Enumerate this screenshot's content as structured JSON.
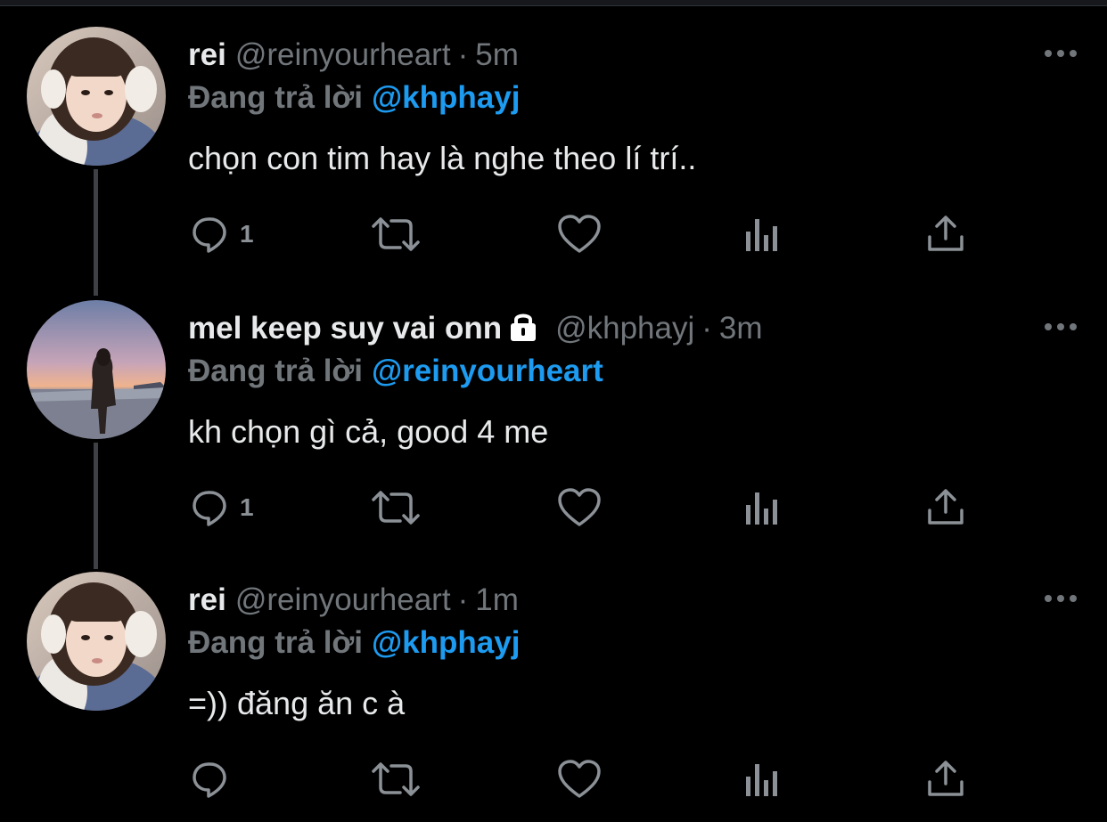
{
  "colors": {
    "background": "#000000",
    "name": "#e7e9ea",
    "muted": "#71767b",
    "mention": "#1d9bf0",
    "thread_line": "#3d4145"
  },
  "tweets": [
    {
      "name": "rei",
      "handle": "@reinyourheart",
      "separator": "·",
      "time": "5m",
      "reply_label": "Đang trả lời",
      "reply_to": "@khphayj",
      "text": "chọn con tim hay là nghe theo lí trí..",
      "reply_count": "1",
      "avatar_icon": "avatar-girl-headphones"
    },
    {
      "name": "mel keep suy vai onn",
      "handle": "@khphayj",
      "separator": "·",
      "time": "3m",
      "reply_label": "Đang trả lời",
      "reply_to": "@reinyourheart",
      "text": "kh chọn gì cả, good 4 me",
      "reply_count": "1",
      "protected_icon": "lock-icon",
      "avatar_icon": "avatar-sunset-silhouette"
    },
    {
      "name": "rei",
      "handle": "@reinyourheart",
      "separator": "·",
      "time": "1m",
      "reply_label": "Đang trả lời",
      "reply_to": "@khphayj",
      "text": "=)) đăng ăn c à",
      "reply_count": "",
      "avatar_icon": "avatar-girl-headphones"
    }
  ],
  "action_icons": [
    "reply-icon",
    "retweet-icon",
    "like-icon",
    "analytics-icon",
    "share-icon"
  ],
  "menu_icon": "more-options-icon"
}
